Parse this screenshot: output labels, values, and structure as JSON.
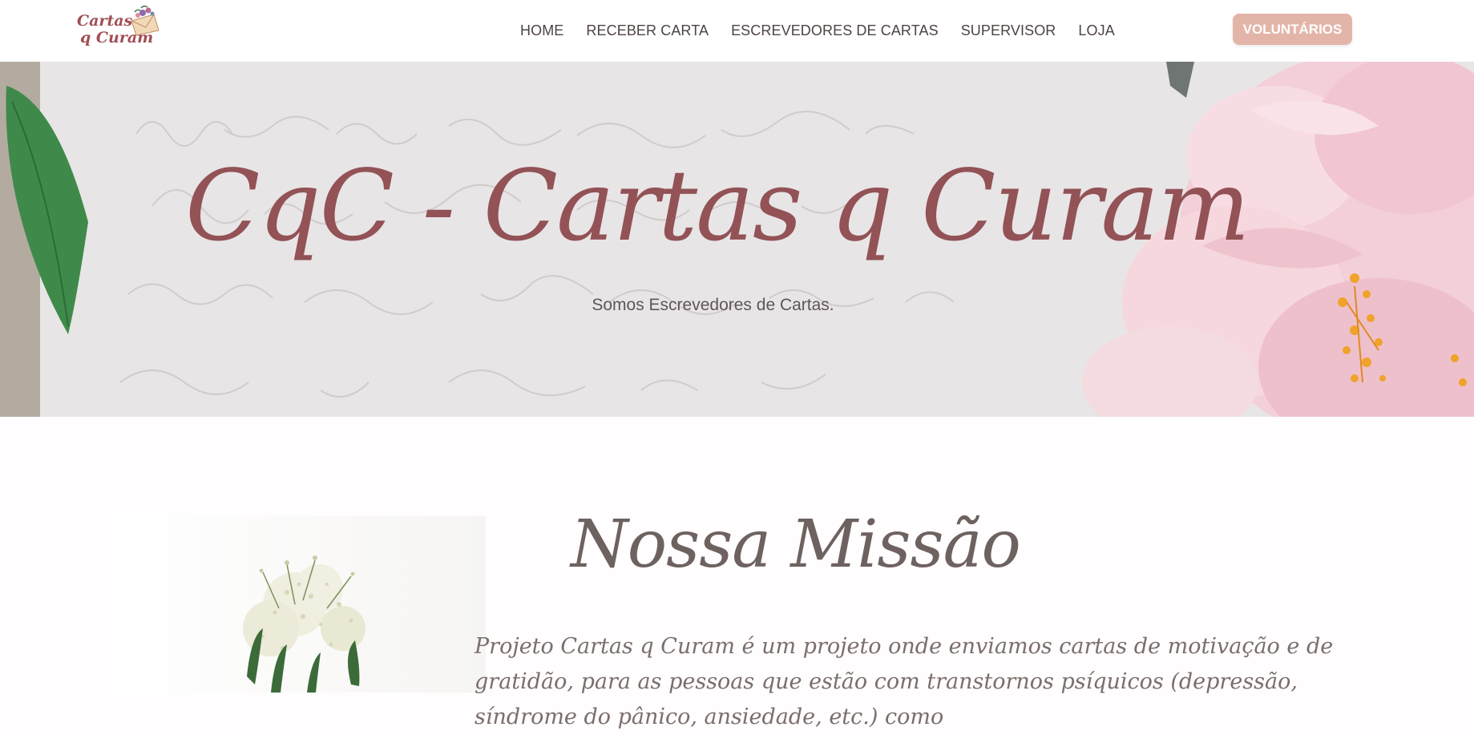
{
  "header": {
    "logo": {
      "line1": "Cartas",
      "line2": "q Curam"
    },
    "nav": [
      "HOME",
      "RECEBER CARTA",
      "ESCREVEDORES DE CARTAS",
      "SUPERVISOR",
      "LOJA"
    ],
    "cta_label": "VOLUNTÁRIOS"
  },
  "hero": {
    "title": "CqC - Cartas q Curam",
    "subtitle": "Somos Escrevedores de Cartas."
  },
  "mission": {
    "title": "Nossa Missão",
    "text": "Projeto Cartas q Curam é um projeto onde enviamos cartas de motivação e de gratidão, para as pessoas que estão com transtornos psíquicos (depressão, síndrome do pânico, ansiedade, etc.) como"
  },
  "colors": {
    "brand": "#925256",
    "cta": "#e3b5a9",
    "nav_text": "#4e4343"
  }
}
